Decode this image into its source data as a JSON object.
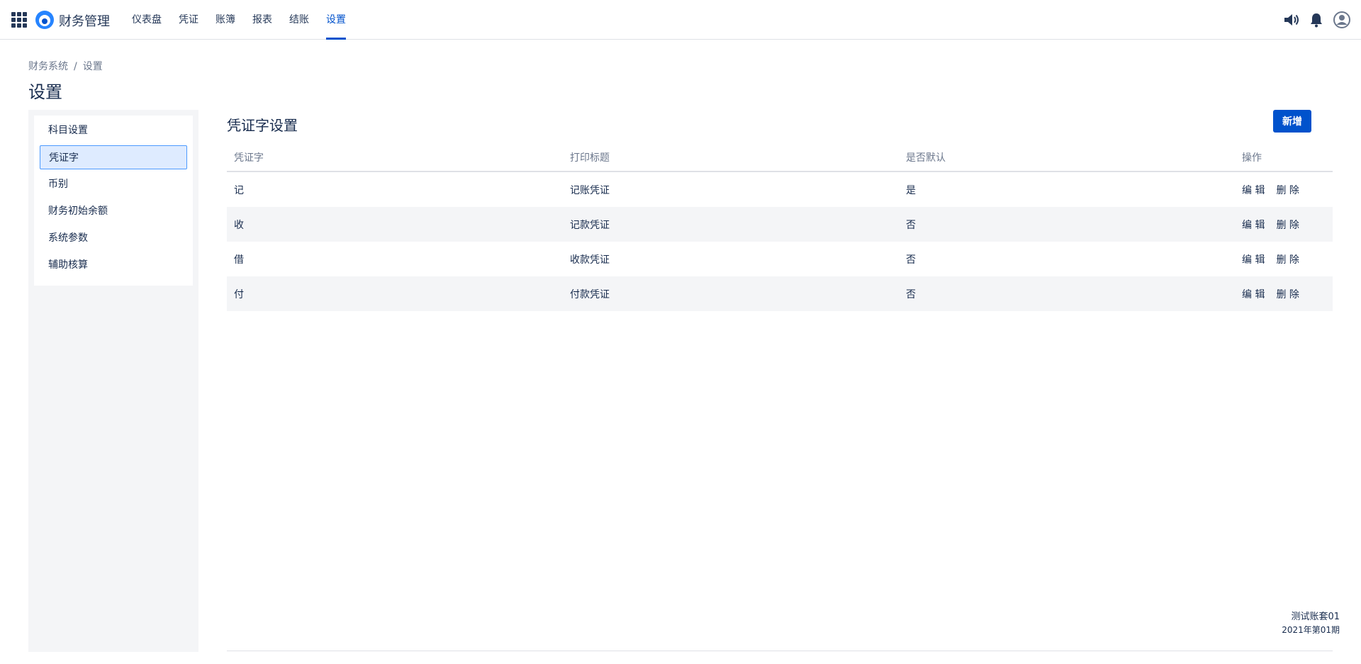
{
  "app": {
    "title": "财务管理",
    "nav": [
      {
        "label": "仪表盘"
      },
      {
        "label": "凭证"
      },
      {
        "label": "账簿"
      },
      {
        "label": "报表"
      },
      {
        "label": "结账"
      },
      {
        "label": "设置",
        "active": true
      }
    ],
    "accent_color": "#0052cc"
  },
  "breadcrumb": {
    "root": "财务系统",
    "separator": "/",
    "current": "设置"
  },
  "page": {
    "title": "设置"
  },
  "sidebar": {
    "items": [
      {
        "label": "科目设置"
      },
      {
        "label": "凭证字",
        "active": true
      },
      {
        "label": "币别"
      },
      {
        "label": "财务初始余额"
      },
      {
        "label": "系统参数"
      },
      {
        "label": "辅助核算"
      }
    ]
  },
  "voucher_settings": {
    "title": "凭证字设置",
    "add_label": "新增",
    "columns": [
      "凭证字",
      "打印标题",
      "是否默认",
      "操作"
    ],
    "rows": [
      {
        "word": "记",
        "print_title": "记账凭证",
        "default": "是"
      },
      {
        "word": "收",
        "print_title": "记款凭证",
        "default": "否"
      },
      {
        "word": "借",
        "print_title": "收款凭证",
        "default": "否"
      },
      {
        "word": "付",
        "print_title": "付款凭证",
        "default": "否"
      }
    ],
    "edit_label": "编 辑",
    "delete_label": "删 除"
  },
  "account": {
    "name": "测试账套01",
    "period": "2021年第01期"
  },
  "icons": {
    "app_switcher": "grid-icon",
    "logo": "logo-icon",
    "speaker": "speaker-icon",
    "bell": "bell-icon",
    "user": "user-icon"
  }
}
